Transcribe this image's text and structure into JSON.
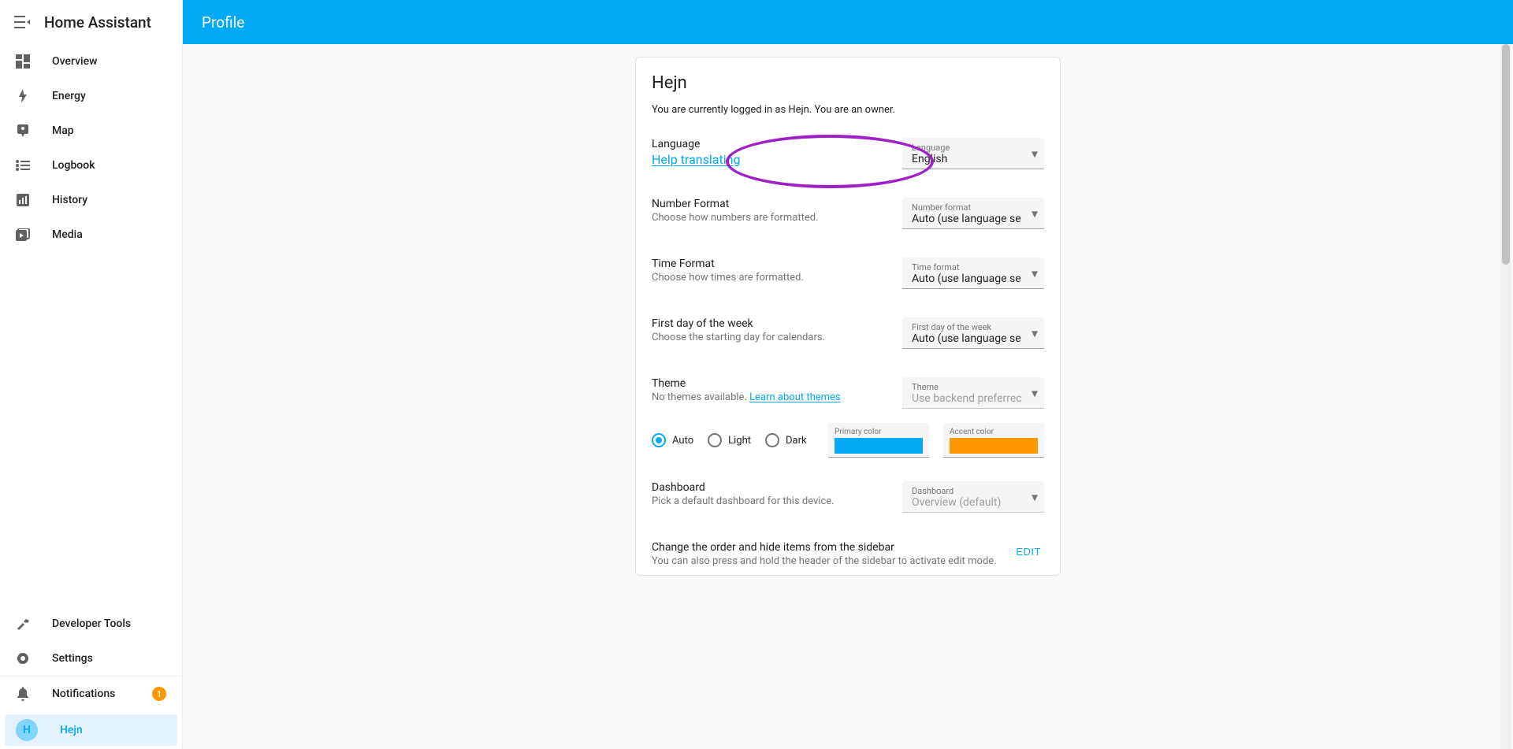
{
  "app": {
    "brand": "Home Assistant",
    "page_title": "Profile"
  },
  "sidebar": {
    "items": [
      {
        "label": "Overview"
      },
      {
        "label": "Energy"
      },
      {
        "label": "Map"
      },
      {
        "label": "Logbook"
      },
      {
        "label": "History"
      },
      {
        "label": "Media"
      }
    ],
    "tools": [
      {
        "label": "Developer Tools"
      },
      {
        "label": "Settings"
      }
    ],
    "notifications": {
      "label": "Notifications",
      "count": "1"
    },
    "user": {
      "initial": "H",
      "name": "Hejn"
    }
  },
  "profile": {
    "name": "Hejn",
    "logged_in": "You are currently logged in as Hejn. You are an owner.",
    "settings": {
      "language": {
        "title": "Language",
        "help_link": "Help translating",
        "select_label": "Language",
        "value": "English"
      },
      "number_format": {
        "title": "Number Format",
        "desc": "Choose how numbers are formatted.",
        "select_label": "Number format",
        "value": "Auto (use language se"
      },
      "time_format": {
        "title": "Time Format",
        "desc": "Choose how times are formatted.",
        "select_label": "Time format",
        "value": "Auto (use language se"
      },
      "first_day": {
        "title": "First day of the week",
        "desc": "Choose the starting day for calendars.",
        "select_label": "First day of the week",
        "value": "Auto (use language se"
      },
      "theme": {
        "title": "Theme",
        "desc_prefix": "No themes available. ",
        "desc_link": "Learn about themes",
        "select_label": "Theme",
        "value": "Use backend preferrec"
      },
      "theme_mode": {
        "options": [
          {
            "label": "Auto"
          },
          {
            "label": "Light"
          },
          {
            "label": "Dark"
          }
        ],
        "primary_label": "Primary color",
        "primary_color": "#03a9f4",
        "accent_label": "Accent color",
        "accent_color": "#ff9800"
      },
      "dashboard": {
        "title": "Dashboard",
        "desc": "Pick a default dashboard for this device.",
        "select_label": "Dashboard",
        "value": "Overview (default)"
      },
      "sidebar_order": {
        "title": "Change the order and hide items from the sidebar",
        "desc": "You can also press and hold the header of the sidebar to activate edit mode.",
        "button": "EDIT"
      }
    }
  }
}
